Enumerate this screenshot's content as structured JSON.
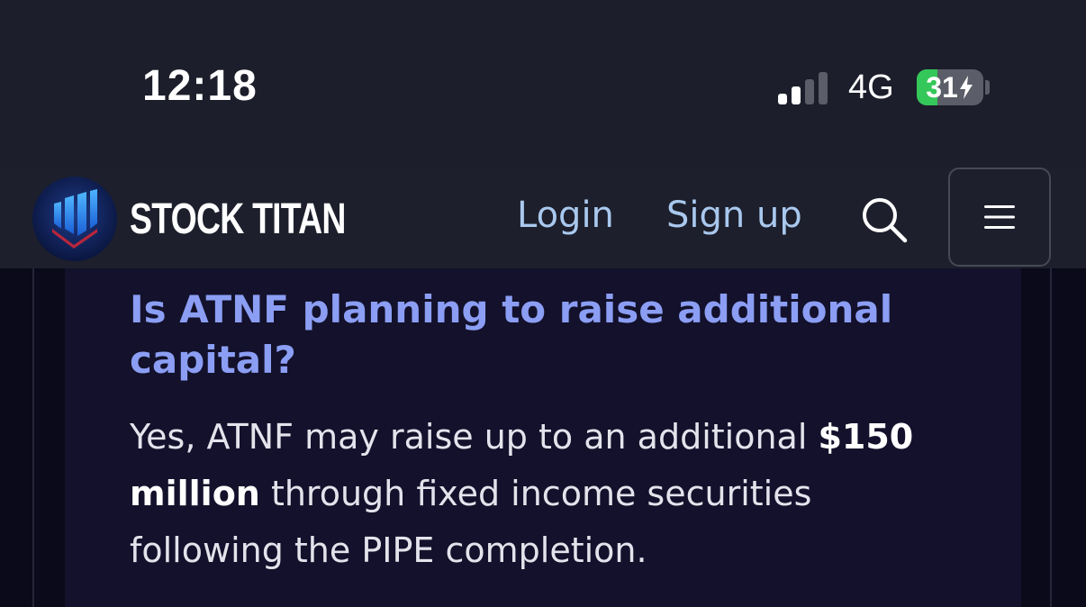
{
  "status_bar": {
    "time": "12:18",
    "network": "4G",
    "battery_level": "31",
    "battery_percent": 31,
    "signal_bars_active": 2,
    "signal_bars_total": 4,
    "charging": true
  },
  "navbar": {
    "brand": "STOCK TITAN",
    "login_label": "Login",
    "signup_label": "Sign up",
    "search_icon": "search-icon",
    "menu_icon": "hamburger-menu-icon"
  },
  "faq": {
    "question": "Is ATNF planning to raise additional capital?",
    "answer_before": "Yes, ATNF may raise up to an additional ",
    "answer_bold": "$150 million",
    "answer_after": " through fixed income securities following the PIPE completion."
  },
  "colors": {
    "accent_question": "#8b9ef4",
    "nav_link": "#a9c8ee",
    "battery_green": "#34c759"
  }
}
